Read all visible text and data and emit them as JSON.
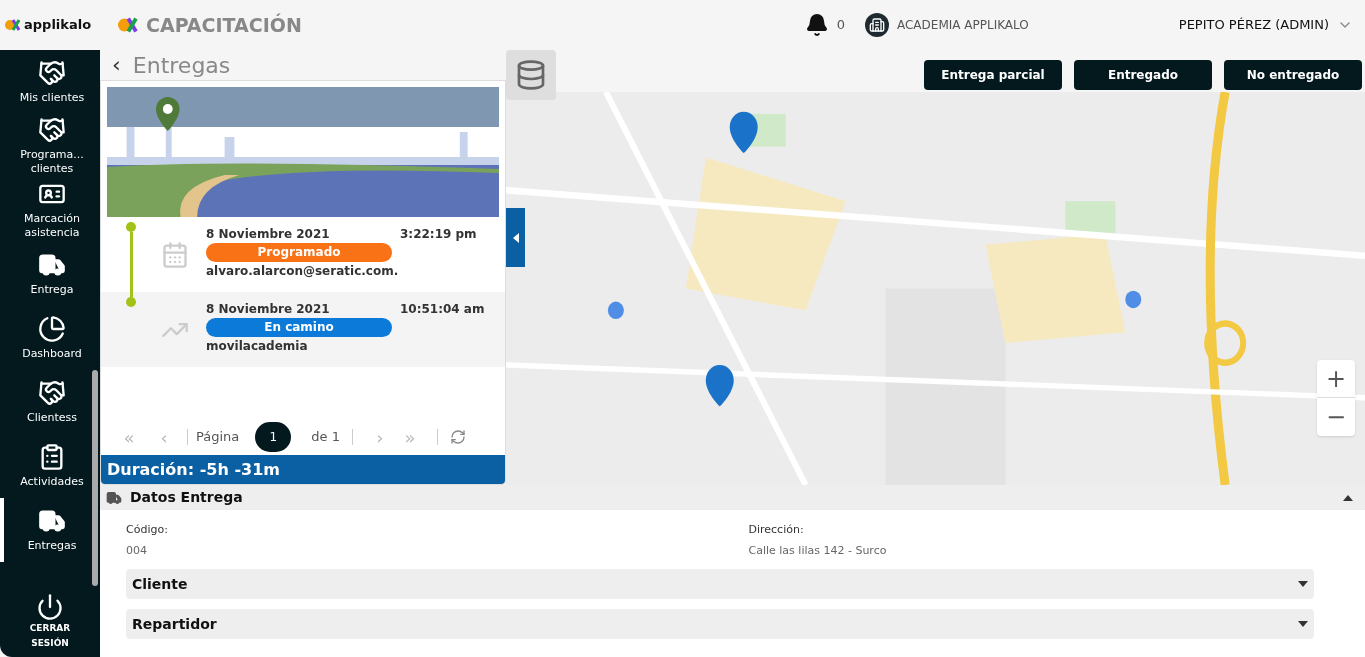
{
  "header": {
    "brand": "applikalo",
    "app_title": "CAPACITACIÓN",
    "notifications": "0",
    "organization": "ACADEMIA APPLIKALO",
    "user": "PEPITO PÉREZ (ADMIN)"
  },
  "sidebar": {
    "items": [
      {
        "label": "Mis clientes",
        "kind": "handshake",
        "selected": false
      },
      {
        "label": "Programa... clientes",
        "kind": "handshake",
        "selected": false
      },
      {
        "label": "Marcación asistencia",
        "kind": "badge",
        "selected": false
      },
      {
        "label": "Entrega",
        "kind": "truck",
        "selected": false
      },
      {
        "label": "Dashboard",
        "kind": "pie",
        "selected": false
      },
      {
        "label": "Clientess",
        "kind": "handshake",
        "selected": false
      },
      {
        "label": "Actividades",
        "kind": "clipboard",
        "selected": false
      },
      {
        "label": "Entregas",
        "kind": "truck",
        "selected": true
      }
    ],
    "logout": "CERRAR SESIÓN"
  },
  "page": {
    "title": "Entregas",
    "back": "‹"
  },
  "actions": [
    "Entrega parcial",
    "Entregado",
    "No entregado"
  ],
  "timeline": [
    {
      "date": "8 Noviembre 2021",
      "time": "3:22:19 pm",
      "status": "Programado",
      "color": "#f97316",
      "user": "alvaro.alarcon@seratic.com.",
      "kind": "calendar"
    },
    {
      "date": "8 Noviembre 2021",
      "time": "10:51:04 am",
      "status": "En camino",
      "color": "#0b7ad8",
      "user": "movilacademia",
      "kind": "trend"
    }
  ],
  "pager": {
    "first": "«",
    "prev": "‹",
    "page_label": "Página",
    "page": "1",
    "of": "de 1",
    "next": "›",
    "last": "»"
  },
  "duration": "Duración: -5h -31m",
  "map": {
    "zoom_in": "+",
    "zoom_out": "−"
  },
  "details": {
    "title": "Datos Entrega",
    "expanded": true,
    "fields": [
      {
        "label": "Código:",
        "value": "004"
      },
      {
        "label": "Dirección:",
        "value": "Calle las lilas 142 - Surco"
      }
    ],
    "sections": [
      {
        "title": "Cliente",
        "expanded": false
      },
      {
        "title": "Repartidor",
        "expanded": false
      }
    ]
  }
}
